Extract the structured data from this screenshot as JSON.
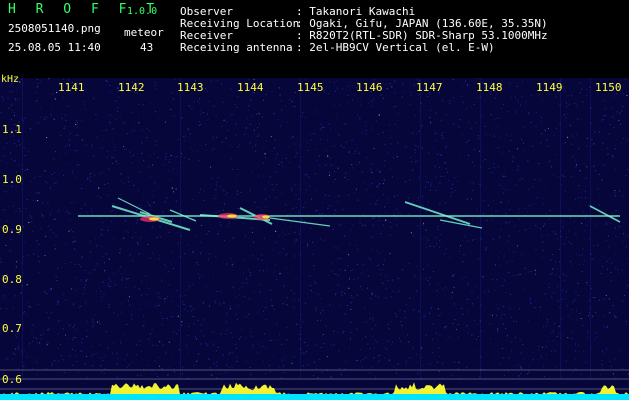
{
  "header": {
    "app_name": "H R O F F T",
    "version": "1.0.0",
    "filename": "2508051140.png",
    "datetime": "25.08.05 11:40",
    "count_label": "meteor",
    "count_value": "43",
    "info": [
      {
        "label": "Observer",
        "value": ": Takanori Kawachi"
      },
      {
        "label": "Receiving Location",
        "value": ": Ogaki, Gifu, JAPAN (136.60E, 35.35N)"
      },
      {
        "label": "Receiver",
        "value": ": R820T2(RTL-SDR) SDR-Sharp 53.1000MHz"
      },
      {
        "label": "Receiving antenna",
        "value": ": 2el-HB9CV Vertical (el. E-W)"
      }
    ]
  },
  "spectrogram": {
    "freq_unit": "kHz",
    "time_ticks": [
      "1141",
      "1142",
      "1143",
      "1144",
      "1145",
      "1146",
      "1147",
      "1148",
      "1149",
      "1150"
    ],
    "freq_ticks": [
      "1.1",
      "1.0",
      "0.9",
      "0.8",
      "0.7",
      "0.6"
    ],
    "colors": {
      "background": "#06063a",
      "noise": "#2a3bd6",
      "carrier": "#7fffd4",
      "meteor_hot": "#ff3366",
      "meteor_warm": "#ffff33",
      "profile_base": "#00e5ff",
      "profile_peak": "#ffff33"
    }
  }
}
